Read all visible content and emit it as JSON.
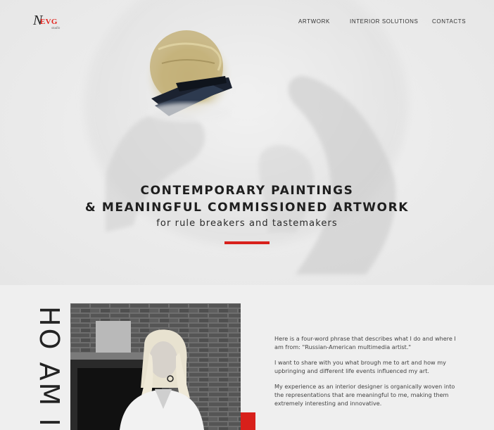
{
  "header": {
    "logo": {
      "initial": "N",
      "mark": "EVG",
      "tagline": "studio"
    },
    "nav": [
      {
        "label": "ARTWORK"
      },
      {
        "label": "INTERIOR SOLUTIONS"
      },
      {
        "label": "CONTACTS"
      }
    ]
  },
  "hero": {
    "title_line1": "CONTEMPORARY PAINTINGS",
    "title_line2": "& MEANINGFUL COMMISSIONED ARTWORK",
    "subtitle": "for rule breakers and tastemakers"
  },
  "about": {
    "heading": "HO AM I?",
    "paragraphs": [
      "Here is a four-word phrase that describes what I do and where I am from: \"Russian-American multimedia artist.\"",
      "I want to share with you what brough me to art and how my upbringing and different life events influenced my art.",
      "My experience as an interior designer is organically woven into the representations that are meaningful to me, making them extremely interesting and innovative."
    ]
  },
  "colors": {
    "accent": "#d8201b",
    "background": "#efefef",
    "text": "#222222"
  }
}
